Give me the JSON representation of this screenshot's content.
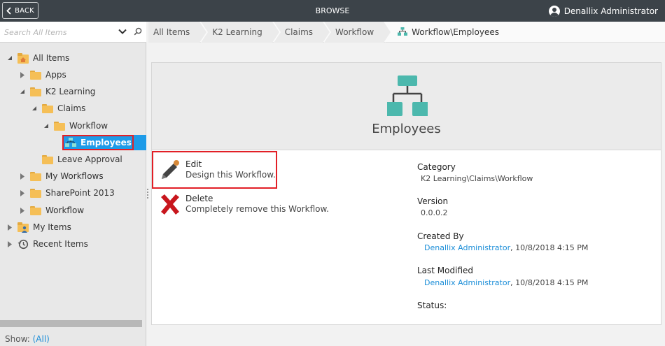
{
  "topbar": {
    "back_label": "BACK",
    "title": "BROWSE",
    "user_name": "Denallix Administrator"
  },
  "sidebar": {
    "search_placeholder": "Search All Items",
    "tree": [
      {
        "label": "All Items",
        "expanded": true,
        "icon": "home-folder-icon"
      },
      {
        "label": "Apps",
        "expanded": false,
        "icon": "folder-icon"
      },
      {
        "label": "K2 Learning",
        "expanded": true,
        "icon": "folder-icon"
      },
      {
        "label": "Claims",
        "expanded": true,
        "icon": "folder-icon"
      },
      {
        "label": "Workflow",
        "expanded": true,
        "icon": "folder-icon"
      },
      {
        "label": "Employees",
        "selected": true,
        "icon": "workflow-icon"
      },
      {
        "label": "Leave Approval",
        "icon": "folder-icon"
      },
      {
        "label": "My Workflows",
        "expanded": false,
        "icon": "folder-icon"
      },
      {
        "label": "SharePoint 2013",
        "expanded": false,
        "icon": "folder-icon"
      },
      {
        "label": "Workflow",
        "expanded": false,
        "icon": "folder-icon"
      },
      {
        "label": "My Items",
        "expanded": false,
        "icon": "user-folder-icon"
      },
      {
        "label": "Recent Items",
        "expanded": false,
        "icon": "history-icon"
      }
    ],
    "show_label": "Show:",
    "show_value": "(All)"
  },
  "breadcrumb": {
    "items": [
      "All Items",
      "K2 Learning",
      "Claims",
      "Workflow"
    ],
    "current": "Workflow\\Employees"
  },
  "card": {
    "title": "Employees",
    "actions": [
      {
        "title": "Edit",
        "description": "Design this Workflow.",
        "icon": "pencil-icon"
      },
      {
        "title": "Delete",
        "description": "Completely remove this Workflow.",
        "icon": "red-x-icon"
      }
    ],
    "properties": {
      "category_label": "Category",
      "category_value": "K2 Learning\\Claims\\Workflow",
      "version_label": "Version",
      "version_value": "0.0.0.2",
      "created_label": "Created By",
      "created_user": "Denallix Administrator",
      "created_date": ", 10/8/2018 4:15 PM",
      "modified_label": "Last Modified",
      "modified_user": "Denallix Administrator",
      "modified_date": ", 10/8/2018 4:15 PM",
      "status_label": "Status:"
    }
  },
  "colors": {
    "topbar": "#3c4349",
    "accent": "#1c8ed8",
    "selection": "#1e9be8",
    "workflow_icon": "#4cb8ad",
    "highlight_box": "#e21f26"
  }
}
